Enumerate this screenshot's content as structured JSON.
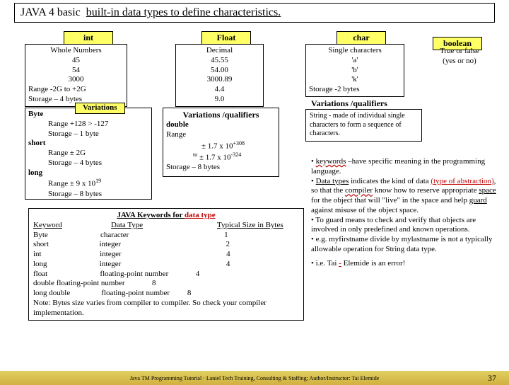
{
  "title_a": "JAVA 4 basic",
  "title_b": "built-in data types to define characteristics.",
  "hdr_int": "int",
  "hdr_float": "Float",
  "hdr_char": "char",
  "hdr_bool": "boolean",
  "int_lines": [
    "Whole Numbers",
    "45",
    "54",
    "3000",
    "Range -2G to +2G",
    "Storage – 4 bytes"
  ],
  "float_lines": [
    "Decimal",
    "45.55",
    "54.00",
    "3000.89",
    "4.4",
    "9.0"
  ],
  "char_lines": [
    "Single characters",
    "'a'",
    "'b'",
    "'k'",
    "Storage -2 bytes"
  ],
  "bool_lines": [
    "True or false",
    "(yes or no)"
  ],
  "varq_char": "Variations /qualifiers",
  "char_string": "String - made of individual single characters to form a sequence of characters.",
  "variations_hdr": "Variations",
  "byte_label": "Byte",
  "byte_range": "Range +128 > -127",
  "byte_storage": "Storage – 1 byte",
  "short_label": "short",
  "short_range": "Range ± 2G",
  "short_storage": "Storage – 4 bytes",
  "long_label": "long",
  "long_range_a": "Range ± 9 x 10",
  "long_range_exp": "19",
  "long_storage": "Storage – 8 bytes",
  "float_varq": "Variations /qualifiers",
  "double_label": "double",
  "double_range": "Range",
  "double_r1a": "± 1.7 x 10",
  "double_r1e": "+308",
  "double_to": "to",
  "double_r2a": "± 1.7 x 10",
  "double_r2e": "-324",
  "double_storage": "Storage – 8 bytes",
  "kw_title_a": "JAVA Keywords for ",
  "kw_title_b": "data type",
  "kw_h1": "Keyword",
  "kw_h2": "Data Type",
  "kw_h3": "Typical Size in Bytes",
  "kw_r1": "Byte                           character                                                 1",
  "kw_r2": "short                          integer                                                      2",
  "kw_r3": "int                              integer                                                      4",
  "kw_r4": "long                           integer                                                      4",
  "kw_r5": "float                           floating-point number              4",
  "kw_r6": "double floating-point number              8",
  "kw_r7": "long double                floating-point number         8",
  "kw_note": "Note: Bytes size varies from compiler to compiler. So check your compiler implementation.",
  "n1a": "• ",
  "n1b": "keywords",
  "n1c": " –have specific meaning in the programming language.",
  "n2a": "• ",
  "n2b": "Data types",
  "n2c": " indicates the kind of data ",
  "n2d": "(type of abstraction)",
  "n2e": ", so that the ",
  "n2f": "compiler",
  "n2g": " know how to reserve appropriate ",
  "n2h": "space",
  "n2i": " for the object that will \"live\" in the space and help ",
  "n2j": "guard",
  "n2k": " against misuse of the object space.",
  "n3": "• To guard means to check and verify that objects are involved in only predefined and known operations.",
  "n4": "• e.g. myfirstname divide by mylastname is not a typically allowable operation for String data type.",
  "n5a": "• i.e. Tai ",
  "n5b": "-",
  "n5c": " Elemide is an error!",
  "footer": "Java TM Programming Tutorial  ·  Laniel Tech Training, Consulting & Staffing; Author/Instructor: Tai Elemide",
  "pgnum": "37"
}
